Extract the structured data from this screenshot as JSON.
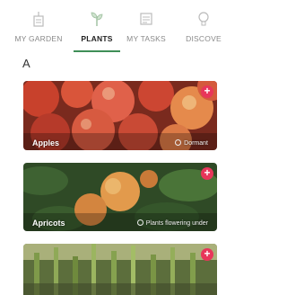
{
  "tabs": [
    {
      "label": "MY GARDEN",
      "icon": "garden-icon",
      "active": false
    },
    {
      "label": "PLANTS",
      "icon": "plant-sprout-icon",
      "active": true
    },
    {
      "label": "MY TASKS",
      "icon": "tasks-icon",
      "active": false
    },
    {
      "label": "DISCOVE",
      "icon": "lightbulb-icon",
      "active": false
    }
  ],
  "section": {
    "letter": "A"
  },
  "plants": [
    {
      "name": "Apples",
      "meta": "Dormant"
    },
    {
      "name": "Apricots",
      "meta": "Plants flowering under"
    },
    {
      "name": "",
      "meta": ""
    }
  ],
  "colors": {
    "accent": "#3f8f57",
    "add_button": "#e8365a"
  }
}
